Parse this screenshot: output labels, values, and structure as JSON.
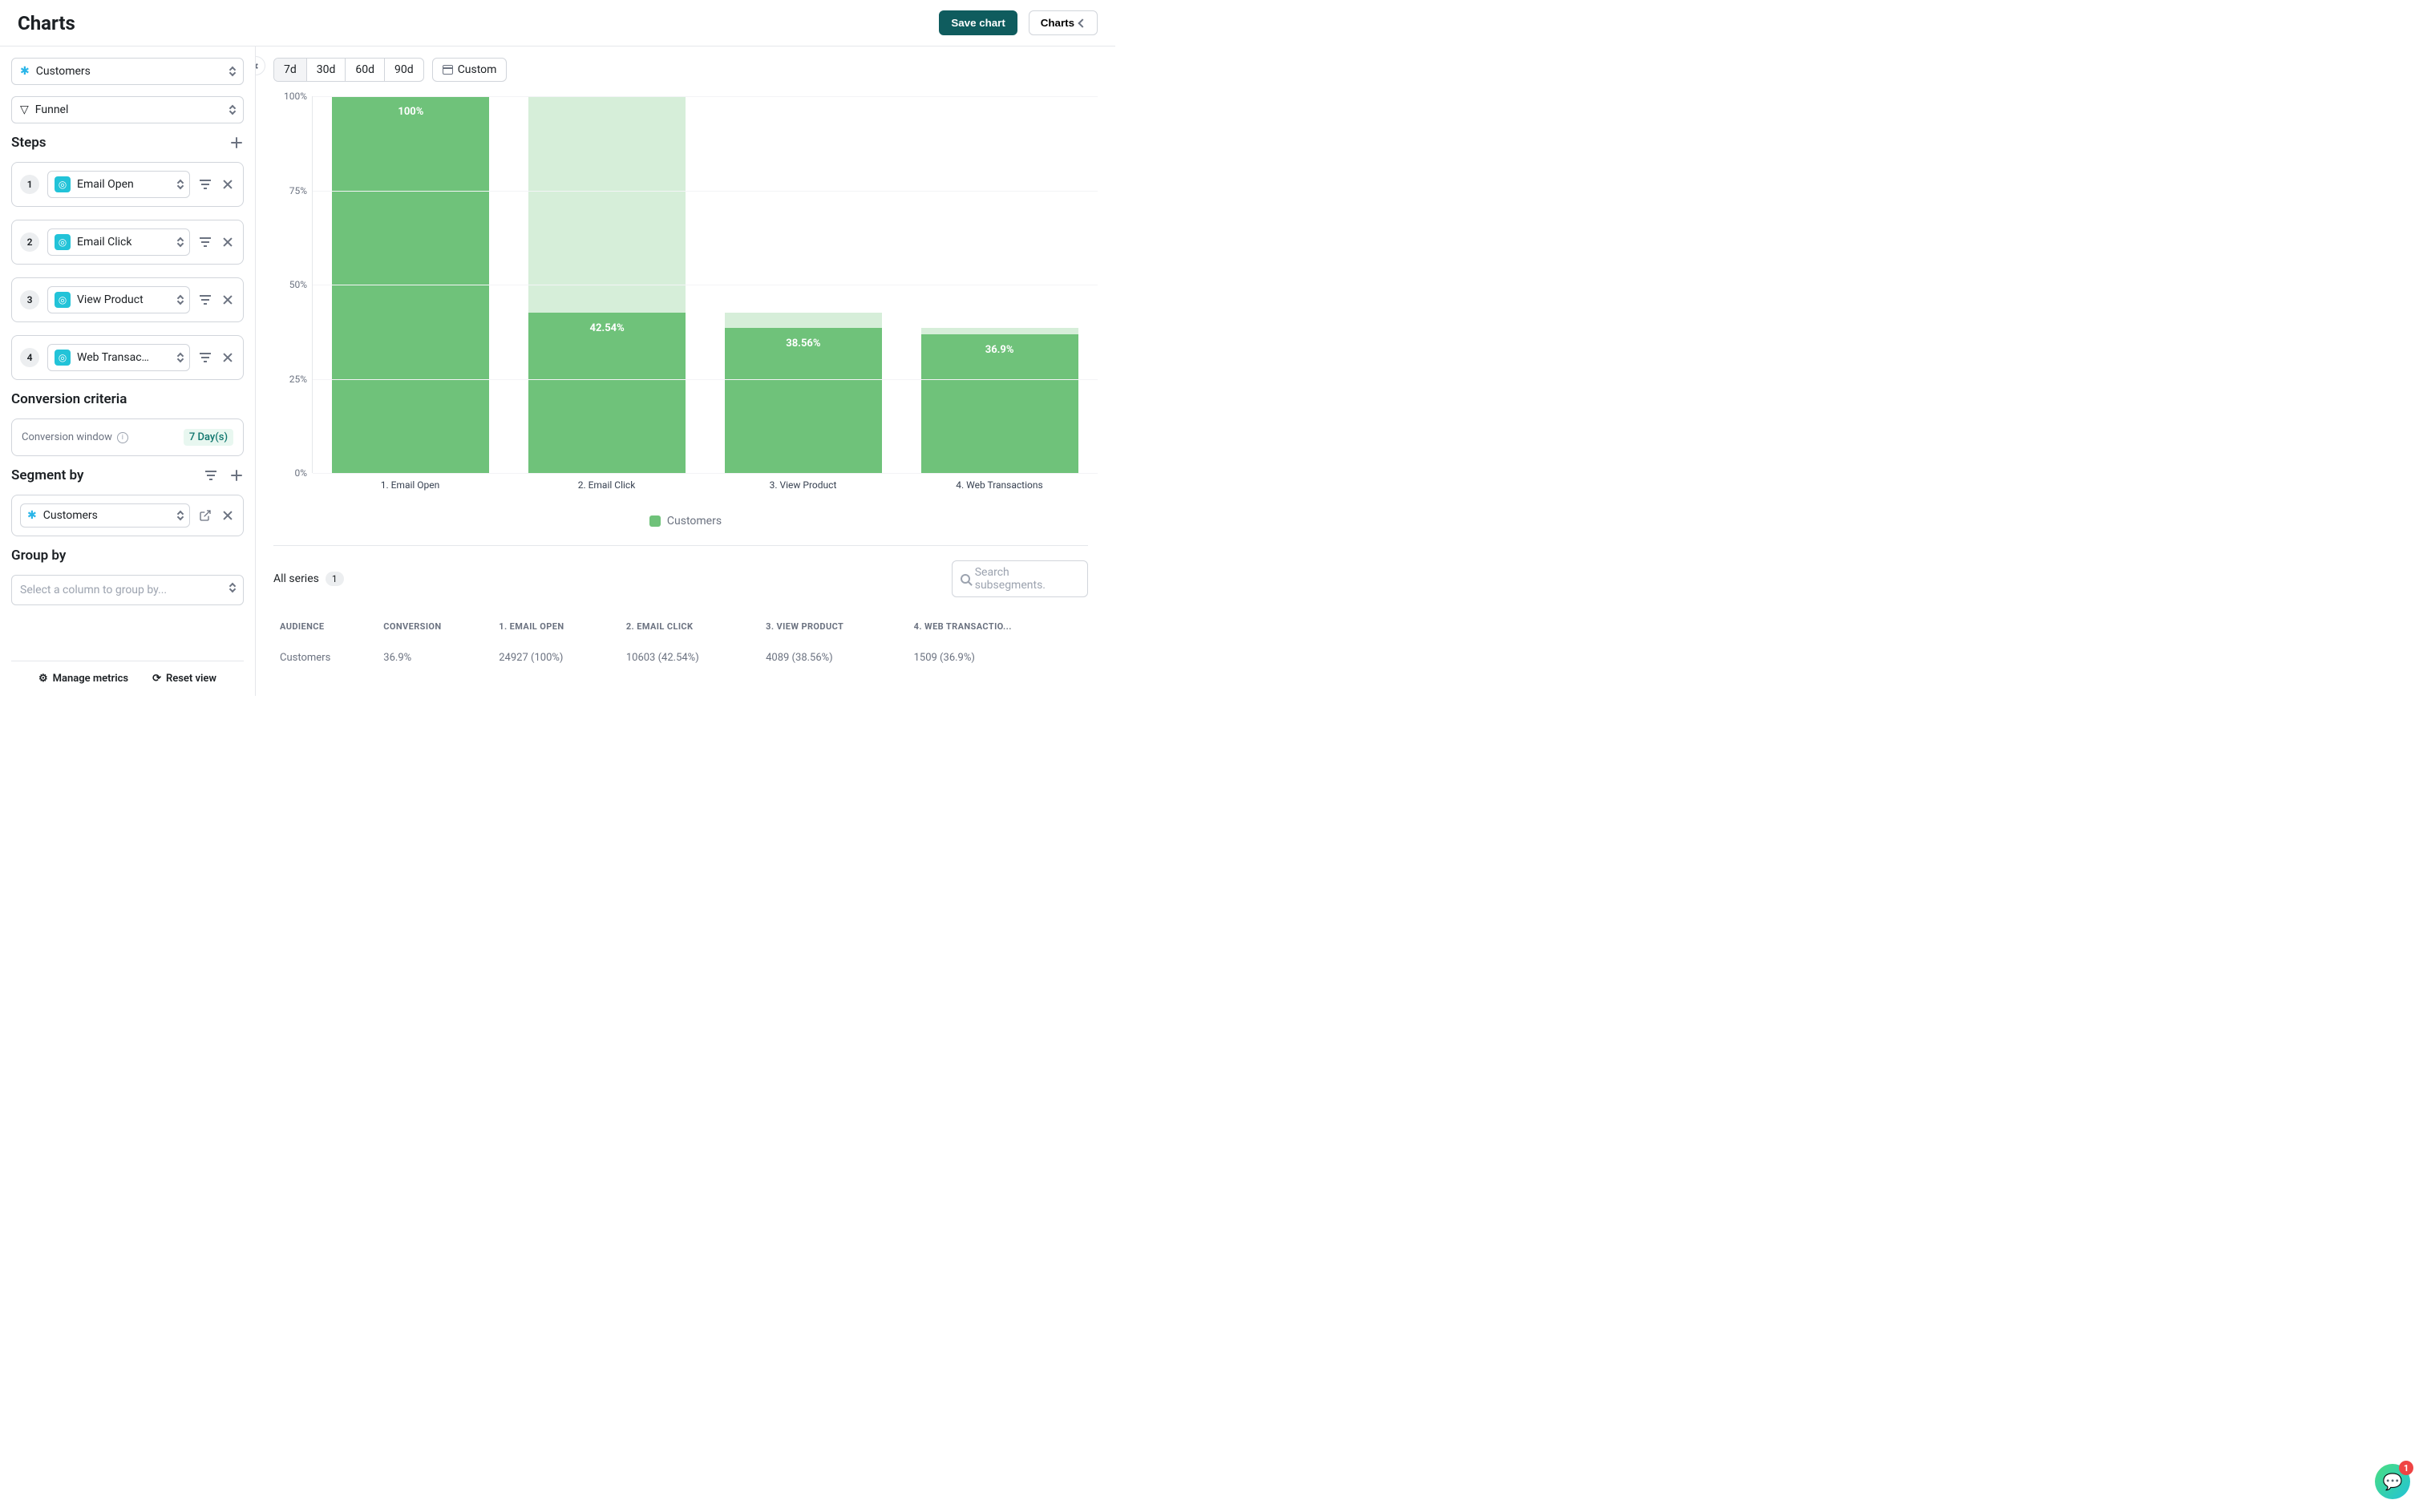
{
  "header": {
    "title": "Charts",
    "save_label": "Save chart",
    "charts_label": "Charts"
  },
  "sidebar": {
    "dataset": "Customers",
    "chart_type": "Funnel",
    "steps_heading": "Steps",
    "steps": [
      {
        "num": "1",
        "label": "Email Open"
      },
      {
        "num": "2",
        "label": "Email Click"
      },
      {
        "num": "3",
        "label": "View Product"
      },
      {
        "num": "4",
        "label": "Web Transacti..."
      }
    ],
    "criteria_heading": "Conversion criteria",
    "conversion_window_label": "Conversion window",
    "conversion_window_value": "7 Day(s)",
    "segment_heading": "Segment by",
    "segment_value": "Customers",
    "groupby_heading": "Group by",
    "groupby_placeholder": "Select a column to group by...",
    "manage_metrics": "Manage metrics",
    "reset_view": "Reset view"
  },
  "range": {
    "options": [
      "7d",
      "30d",
      "60d",
      "90d"
    ],
    "active": 0,
    "custom_label": "Custom"
  },
  "chart_data": {
    "type": "bar",
    "title": "",
    "xlabel": "",
    "ylabel": "",
    "ylim": [
      0,
      100
    ],
    "yticks": [
      "0%",
      "25%",
      "50%",
      "75%",
      "100%"
    ],
    "categories": [
      "1. Email Open",
      "2. Email Click",
      "3. View Product",
      "4. Web Transactions"
    ],
    "series": [
      {
        "name": "Customers",
        "values": [
          100,
          42.54,
          38.56,
          36.9
        ],
        "labels": [
          "100%",
          "42.54%",
          "38.56%",
          "36.9%"
        ]
      }
    ],
    "ghost_top_pct": [
      100,
      100,
      42.54,
      38.56
    ]
  },
  "legend": {
    "label": "Customers"
  },
  "series_header": {
    "label": "All series",
    "count": "1",
    "search_placeholder": "Search subsegments."
  },
  "table": {
    "columns": [
      "AUDIENCE",
      "CONVERSION",
      "1. EMAIL OPEN",
      "2. EMAIL CLICK",
      "3. VIEW PRODUCT",
      "4. WEB TRANSACTIO..."
    ],
    "rows": [
      {
        "audience": "Customers",
        "conversion": "36.9%",
        "c1": "24927 (100%)",
        "c2": "10603 (42.54%)",
        "c3": "4089 (38.56%)",
        "c4": "1509 (36.9%)"
      }
    ]
  },
  "chat_badge": "1"
}
